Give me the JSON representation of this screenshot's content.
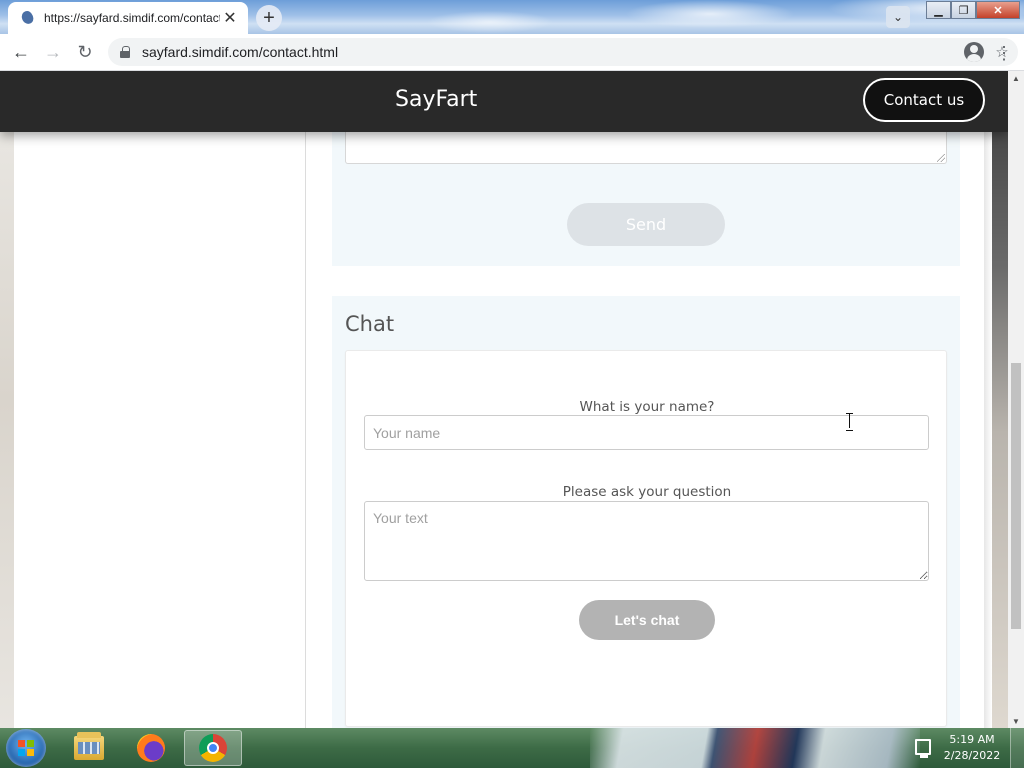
{
  "browser": {
    "tab_title": "https://sayfard.simdif.com/contact.html",
    "tab_close": "✕",
    "new_tab": "+",
    "tab_search": "⌄",
    "url": "sayfard.simdif.com/contact.html",
    "back": "←",
    "forward": "→",
    "reload": "↻",
    "share": "⇪",
    "bookmark": "☆",
    "menu": "⋮",
    "window_minimize": "▁",
    "window_restore": "❐",
    "window_close": "✕"
  },
  "site": {
    "title": "SayFart",
    "contact_button": "Contact us"
  },
  "contact_form": {
    "send_button": "Send"
  },
  "chat": {
    "heading": "Chat",
    "name_label": "What is your name?",
    "name_placeholder": "Your name",
    "question_label": "Please ask your question",
    "text_placeholder": "Your text",
    "chat_button": "Let's chat"
  },
  "scrollbar": {
    "up": "▲",
    "down": "▼"
  },
  "taskbar": {
    "time": "5:19 AM",
    "date": "2/28/2022",
    "items": [
      "windows-explorer",
      "firefox",
      "chrome"
    ]
  },
  "colors": {
    "header_bg": "#292929",
    "card_bg": "#f2f8fb",
    "send_button_bg": "#dde2e6",
    "chat_button_bg": "#b3b3b3"
  }
}
